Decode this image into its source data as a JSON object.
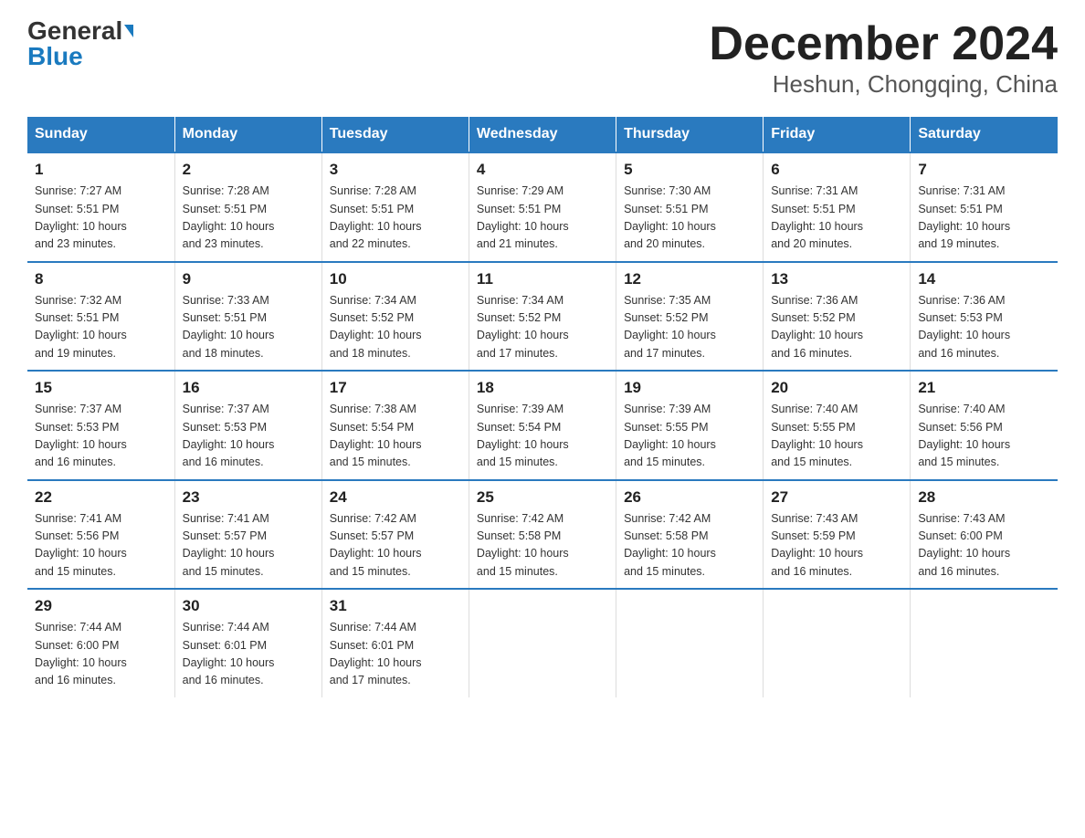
{
  "logo": {
    "general": "General",
    "blue": "Blue"
  },
  "title": "December 2024",
  "subtitle": "Heshun, Chongqing, China",
  "days_header": [
    "Sunday",
    "Monday",
    "Tuesday",
    "Wednesday",
    "Thursday",
    "Friday",
    "Saturday"
  ],
  "weeks": [
    [
      {
        "num": "1",
        "info": "Sunrise: 7:27 AM\nSunset: 5:51 PM\nDaylight: 10 hours\nand 23 minutes."
      },
      {
        "num": "2",
        "info": "Sunrise: 7:28 AM\nSunset: 5:51 PM\nDaylight: 10 hours\nand 23 minutes."
      },
      {
        "num": "3",
        "info": "Sunrise: 7:28 AM\nSunset: 5:51 PM\nDaylight: 10 hours\nand 22 minutes."
      },
      {
        "num": "4",
        "info": "Sunrise: 7:29 AM\nSunset: 5:51 PM\nDaylight: 10 hours\nand 21 minutes."
      },
      {
        "num": "5",
        "info": "Sunrise: 7:30 AM\nSunset: 5:51 PM\nDaylight: 10 hours\nand 20 minutes."
      },
      {
        "num": "6",
        "info": "Sunrise: 7:31 AM\nSunset: 5:51 PM\nDaylight: 10 hours\nand 20 minutes."
      },
      {
        "num": "7",
        "info": "Sunrise: 7:31 AM\nSunset: 5:51 PM\nDaylight: 10 hours\nand 19 minutes."
      }
    ],
    [
      {
        "num": "8",
        "info": "Sunrise: 7:32 AM\nSunset: 5:51 PM\nDaylight: 10 hours\nand 19 minutes."
      },
      {
        "num": "9",
        "info": "Sunrise: 7:33 AM\nSunset: 5:51 PM\nDaylight: 10 hours\nand 18 minutes."
      },
      {
        "num": "10",
        "info": "Sunrise: 7:34 AM\nSunset: 5:52 PM\nDaylight: 10 hours\nand 18 minutes."
      },
      {
        "num": "11",
        "info": "Sunrise: 7:34 AM\nSunset: 5:52 PM\nDaylight: 10 hours\nand 17 minutes."
      },
      {
        "num": "12",
        "info": "Sunrise: 7:35 AM\nSunset: 5:52 PM\nDaylight: 10 hours\nand 17 minutes."
      },
      {
        "num": "13",
        "info": "Sunrise: 7:36 AM\nSunset: 5:52 PM\nDaylight: 10 hours\nand 16 minutes."
      },
      {
        "num": "14",
        "info": "Sunrise: 7:36 AM\nSunset: 5:53 PM\nDaylight: 10 hours\nand 16 minutes."
      }
    ],
    [
      {
        "num": "15",
        "info": "Sunrise: 7:37 AM\nSunset: 5:53 PM\nDaylight: 10 hours\nand 16 minutes."
      },
      {
        "num": "16",
        "info": "Sunrise: 7:37 AM\nSunset: 5:53 PM\nDaylight: 10 hours\nand 16 minutes."
      },
      {
        "num": "17",
        "info": "Sunrise: 7:38 AM\nSunset: 5:54 PM\nDaylight: 10 hours\nand 15 minutes."
      },
      {
        "num": "18",
        "info": "Sunrise: 7:39 AM\nSunset: 5:54 PM\nDaylight: 10 hours\nand 15 minutes."
      },
      {
        "num": "19",
        "info": "Sunrise: 7:39 AM\nSunset: 5:55 PM\nDaylight: 10 hours\nand 15 minutes."
      },
      {
        "num": "20",
        "info": "Sunrise: 7:40 AM\nSunset: 5:55 PM\nDaylight: 10 hours\nand 15 minutes."
      },
      {
        "num": "21",
        "info": "Sunrise: 7:40 AM\nSunset: 5:56 PM\nDaylight: 10 hours\nand 15 minutes."
      }
    ],
    [
      {
        "num": "22",
        "info": "Sunrise: 7:41 AM\nSunset: 5:56 PM\nDaylight: 10 hours\nand 15 minutes."
      },
      {
        "num": "23",
        "info": "Sunrise: 7:41 AM\nSunset: 5:57 PM\nDaylight: 10 hours\nand 15 minutes."
      },
      {
        "num": "24",
        "info": "Sunrise: 7:42 AM\nSunset: 5:57 PM\nDaylight: 10 hours\nand 15 minutes."
      },
      {
        "num": "25",
        "info": "Sunrise: 7:42 AM\nSunset: 5:58 PM\nDaylight: 10 hours\nand 15 minutes."
      },
      {
        "num": "26",
        "info": "Sunrise: 7:42 AM\nSunset: 5:58 PM\nDaylight: 10 hours\nand 15 minutes."
      },
      {
        "num": "27",
        "info": "Sunrise: 7:43 AM\nSunset: 5:59 PM\nDaylight: 10 hours\nand 16 minutes."
      },
      {
        "num": "28",
        "info": "Sunrise: 7:43 AM\nSunset: 6:00 PM\nDaylight: 10 hours\nand 16 minutes."
      }
    ],
    [
      {
        "num": "29",
        "info": "Sunrise: 7:44 AM\nSunset: 6:00 PM\nDaylight: 10 hours\nand 16 minutes."
      },
      {
        "num": "30",
        "info": "Sunrise: 7:44 AM\nSunset: 6:01 PM\nDaylight: 10 hours\nand 16 minutes."
      },
      {
        "num": "31",
        "info": "Sunrise: 7:44 AM\nSunset: 6:01 PM\nDaylight: 10 hours\nand 17 minutes."
      },
      {
        "num": "",
        "info": ""
      },
      {
        "num": "",
        "info": ""
      },
      {
        "num": "",
        "info": ""
      },
      {
        "num": "",
        "info": ""
      }
    ]
  ]
}
